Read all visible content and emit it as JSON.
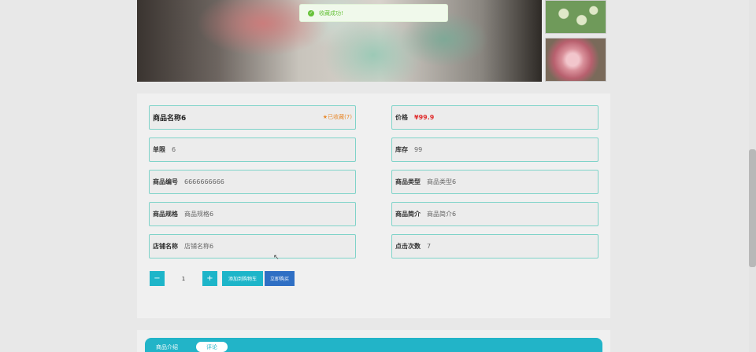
{
  "toast": {
    "message": "收藏成功!"
  },
  "product": {
    "name": "商品名称6",
    "favorite": "已收藏(7)",
    "fields": [
      {
        "label": "价格",
        "value": "¥99.9"
      },
      {
        "label": "单限",
        "value": "6"
      },
      {
        "label": "库存",
        "value": "99"
      },
      {
        "label": "商品编号",
        "value": "6666666666"
      },
      {
        "label": "商品类型",
        "value": "商品类型6"
      },
      {
        "label": "商品规格",
        "value": "商品规格6"
      },
      {
        "label": "商品简介",
        "value": "商品简介6"
      },
      {
        "label": "店铺名称",
        "value": "店铺名称6"
      },
      {
        "label": "点击次数",
        "value": "7"
      }
    ]
  },
  "purchase": {
    "minus": "−",
    "plus": "+",
    "quantity": "1",
    "add_to_cart": "添加到购物车",
    "buy_now": "立即购买"
  },
  "tabs": [
    {
      "label": "商品介绍"
    },
    {
      "label": "评论"
    }
  ],
  "colors": {
    "accent": "#1db5c9",
    "buy_now": "#2f6fc4",
    "price": "#e03030",
    "favorite": "#e88a2e",
    "field_border": "#7fd3c9",
    "toast_green": "#67c23a"
  },
  "icons": {
    "toast": "check-circle-icon",
    "favorite": "star-icon",
    "cursor": "mouse-pointer-icon"
  }
}
